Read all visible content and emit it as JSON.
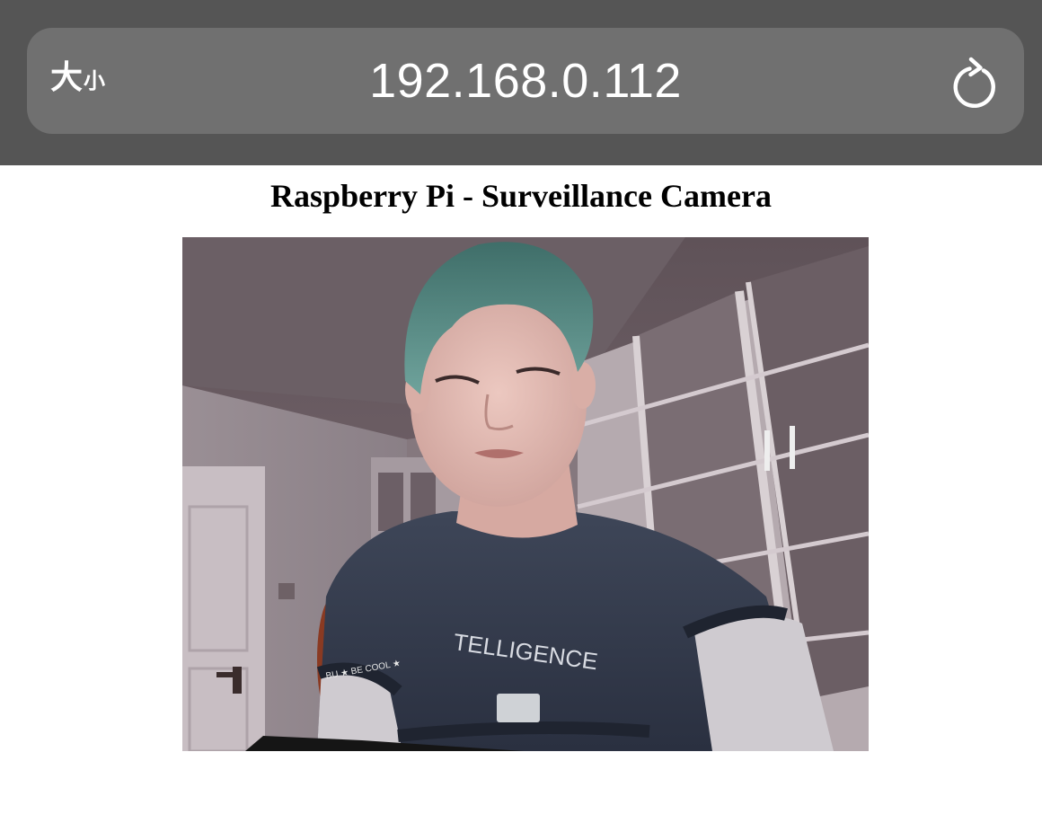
{
  "browser": {
    "text_size_big": "大",
    "text_size_small": "小",
    "url": "192.168.0.112",
    "reload_icon": "reload-icon",
    "chrome_color": "#555555",
    "address_bar_color": "#707070"
  },
  "page": {
    "title": "Raspberry Pi - Surveillance Camera"
  },
  "video_feed": {
    "shirt_text": "TELLIGENCE",
    "sleeve_text": "BU ★ BE COOL ★"
  }
}
